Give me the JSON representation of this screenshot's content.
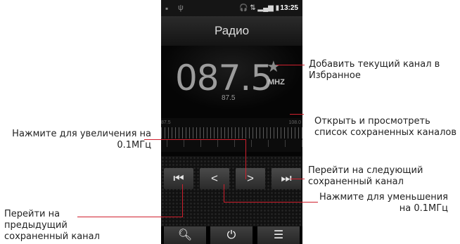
{
  "status_bar": {
    "time": "13:25",
    "left_icons": [
      "gallery-icon",
      "usb-icon"
    ],
    "right_icons": [
      "headphones-icon",
      "data-icon",
      "signal-icon",
      "battery-icon"
    ]
  },
  "app": {
    "title": "Радио",
    "frequency": "087.5",
    "unit": "MHZ",
    "sub_frequency": "87.5",
    "scale_min": "87.5",
    "scale_max": "108.0"
  },
  "controls": {
    "prev_channel": "⏮",
    "decrease": "<",
    "increase": ">",
    "next_channel": "⏭"
  },
  "bottom_bar": {
    "search": "search-icon",
    "power": "power-icon",
    "list": "list-icon"
  },
  "annotations": {
    "favorite_line1": "Добавить текущий канал в",
    "favorite_line2": "Избранное",
    "list_line1": "Открыть и просмотреть",
    "list_line2": "список сохраненных каналов",
    "increase_line1": "Нажмите для увеличения на",
    "increase_line2": "0.1МГц",
    "next_line1": "Перейти на следующий",
    "next_line2": "сохраненный канал",
    "decrease_line1": "Нажмите для уменьшения",
    "decrease_line2": "на 0.1МГц",
    "prev_line1": "Перейти на",
    "prev_line2": "предыдущий",
    "prev_line3": "сохраненный канал"
  },
  "colors": {
    "annotation_line": "#d0202e",
    "phone_background": "#050505"
  }
}
